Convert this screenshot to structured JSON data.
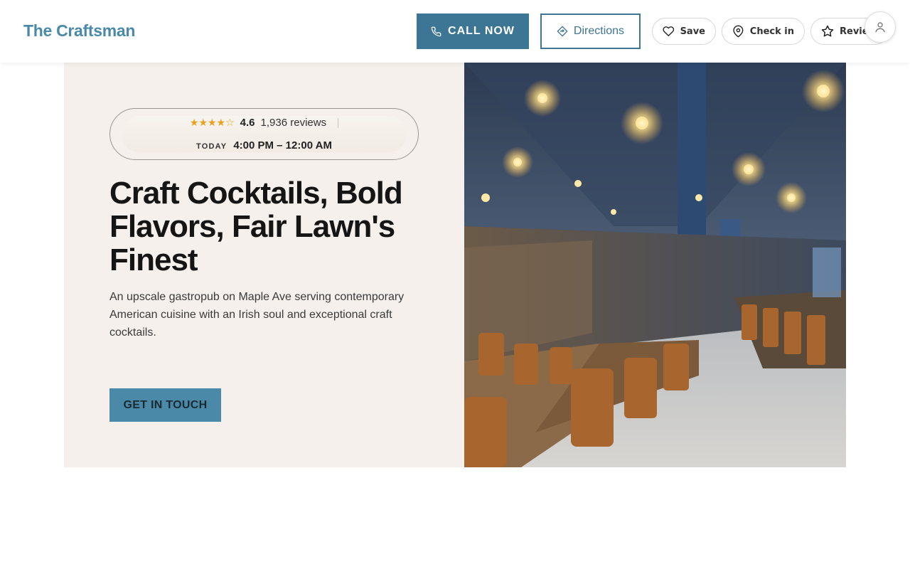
{
  "header": {
    "logo": "The Craftsman",
    "call_label": "CALL NOW",
    "directions_label": "Directions",
    "save_label": "Save",
    "checkin_label": "Check in",
    "review_label": "Review"
  },
  "hero": {
    "stars": "★★★★☆",
    "rating": "4.6",
    "reviews": "1,936 reviews",
    "today_label": "TODAY",
    "hours": "4:00 PM – 12:00 AM",
    "headline": "Craft Cocktails, Bold Flavors, Fair Lawn's Finest",
    "description": "An upscale gastropub on Maple Ave serving contemporary American cuisine with an Irish soul and exceptional craft cocktails.",
    "cta_label": "GET IN TOUCH"
  },
  "colors": {
    "accent": "#4a8aa8",
    "accent_dark": "#3d7594",
    "hero_bg": "#f5f0eb",
    "star": "#e8a21d"
  },
  "icons": [
    "phone-icon",
    "directions-icon",
    "heart-icon",
    "map-pin-icon",
    "star-outline-icon",
    "user-icon"
  ]
}
